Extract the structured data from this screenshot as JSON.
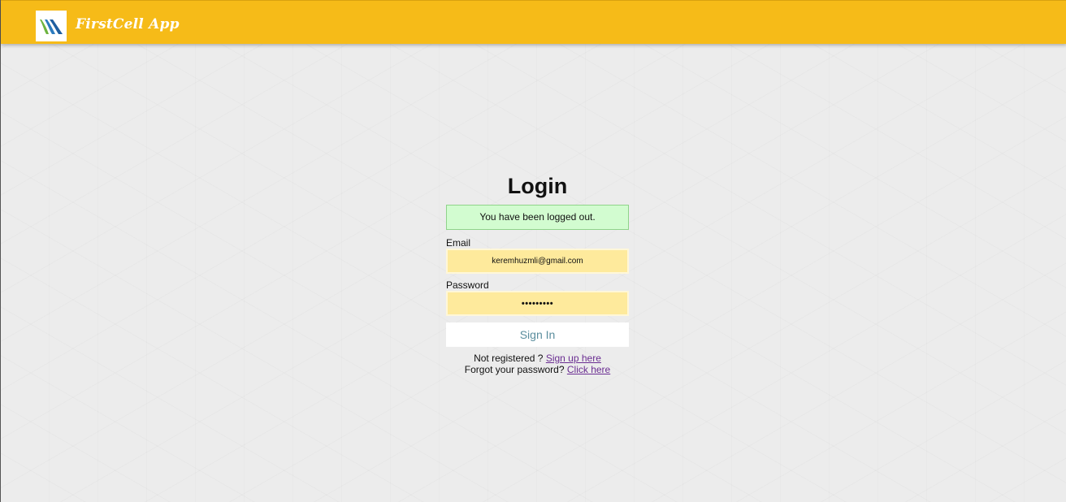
{
  "navbar": {
    "brand": "FirstCell App",
    "logo_icon": "firstcell-logo",
    "color": "#f6bb18"
  },
  "login": {
    "title": "Login",
    "alert": "You have been logged out.",
    "email_label": "Email",
    "email_value": "keremhuzmli@gmail.com",
    "password_label": "Password",
    "password_value": "•••••••••",
    "signin_label": "Sign In",
    "register_prompt": "Not registered ?",
    "register_link": "Sign up here",
    "forgot_prompt": "Forgot your password?",
    "forgot_link": "Click here"
  },
  "colors": {
    "alert_bg": "#d2fcd0",
    "input_bg": "#feea9c",
    "link": "#6a2d91"
  }
}
